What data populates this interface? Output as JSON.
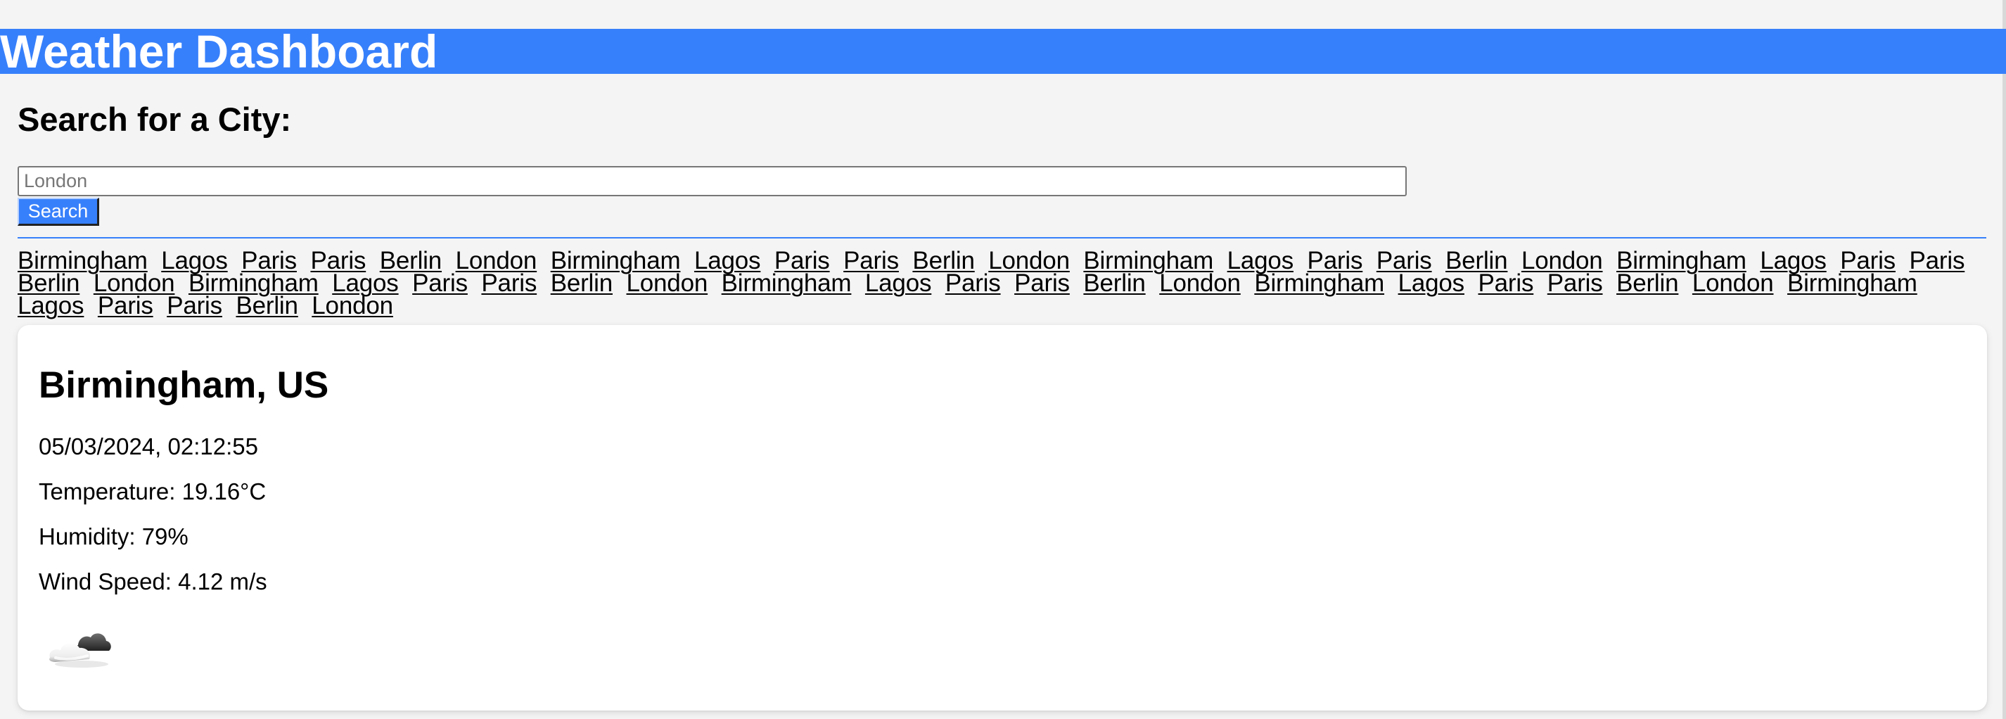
{
  "header": {
    "title": "Weather Dashboard"
  },
  "search": {
    "title": "Search for a City:",
    "placeholder": "London",
    "button_label": "Search"
  },
  "history": {
    "cities": [
      "Birmingham",
      "Lagos",
      "Paris",
      "Paris",
      "Berlin",
      "London",
      "Birmingham",
      "Lagos",
      "Paris",
      "Paris",
      "Berlin",
      "London",
      "Birmingham",
      "Lagos",
      "Paris",
      "Paris",
      "Berlin",
      "London",
      "Birmingham",
      "Lagos",
      "Paris",
      "Paris",
      "Berlin",
      "London",
      "Birmingham",
      "Lagos",
      "Paris",
      "Paris",
      "Berlin",
      "London",
      "Birmingham",
      "Lagos",
      "Paris",
      "Paris",
      "Berlin",
      "London",
      "Birmingham",
      "Lagos",
      "Paris",
      "Paris",
      "Berlin",
      "London",
      "Birmingham",
      "Lagos",
      "Paris",
      "Paris",
      "Berlin",
      "London"
    ]
  },
  "weather": {
    "city": "Birmingham, US",
    "datetime": "05/03/2024, 02:12:55",
    "temperature": "Temperature: 19.16°C",
    "humidity": "Humidity: 79%",
    "wind_speed": "Wind Speed: 4.12 m/s",
    "icon": "partly-cloudy-night-icon"
  },
  "colors": {
    "accent": "#3780fb",
    "background": "#f4f4f4",
    "card": "#ffffff"
  }
}
